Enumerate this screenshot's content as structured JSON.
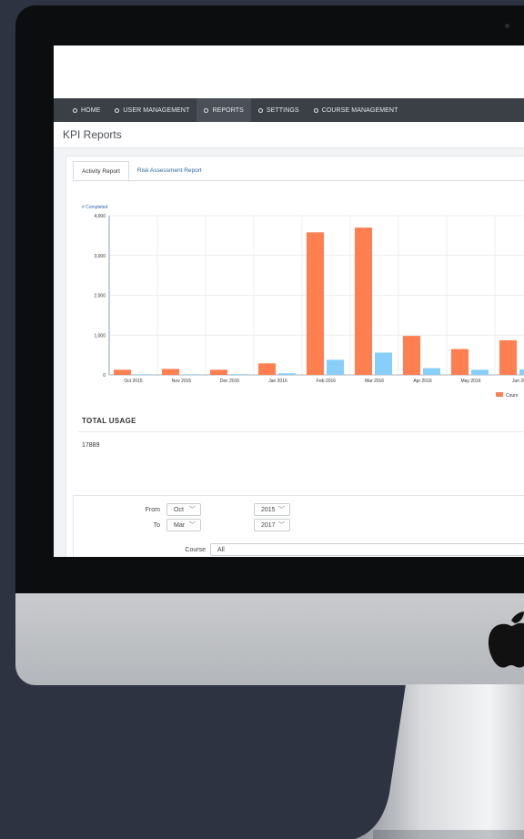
{
  "nav": {
    "items": [
      {
        "label": "HOME",
        "active": false
      },
      {
        "label": "USER MANAGEMENT",
        "active": false
      },
      {
        "label": "REPORTS",
        "active": true
      },
      {
        "label": "SETTINGS",
        "active": false
      },
      {
        "label": "COURSE MANAGEMENT",
        "active": false
      }
    ]
  },
  "page": {
    "title": "KPI Reports"
  },
  "tabs": [
    {
      "label": "Activity Report",
      "active": true
    },
    {
      "label": "Risk Assessment Report",
      "active": false
    }
  ],
  "chart_data": {
    "type": "bar",
    "ylabel": "# Completed",
    "ylim": [
      0,
      4000
    ],
    "yticks": [
      "4,000",
      "3,000",
      "2,000",
      "1,000",
      "0"
    ],
    "categories": [
      "Oct 2015",
      "Nov 2015",
      "Dec 2015",
      "Jan 2016",
      "Feb 2016",
      "Mar 2016",
      "Apr 2016",
      "May 2016",
      "Jun 20"
    ],
    "series": [
      {
        "name": "Cours",
        "color": "#ff7f50",
        "values": [
          130,
          150,
          130,
          290,
          3580,
          3700,
          980,
          650,
          870
        ]
      },
      {
        "name": "",
        "color": "#87cefa",
        "values": [
          15,
          15,
          20,
          40,
          380,
          560,
          170,
          130,
          140
        ]
      }
    ],
    "grid": true,
    "legend": "bottom-right"
  },
  "totals": {
    "title": "TOTAL USAGE",
    "value": "17889"
  },
  "filters": {
    "from_label": "From",
    "to_label": "To",
    "from_month": "Oct",
    "from_year": "2015",
    "to_month": "Mar",
    "to_year": "2017",
    "course_label": "Course",
    "course_value": "All"
  }
}
